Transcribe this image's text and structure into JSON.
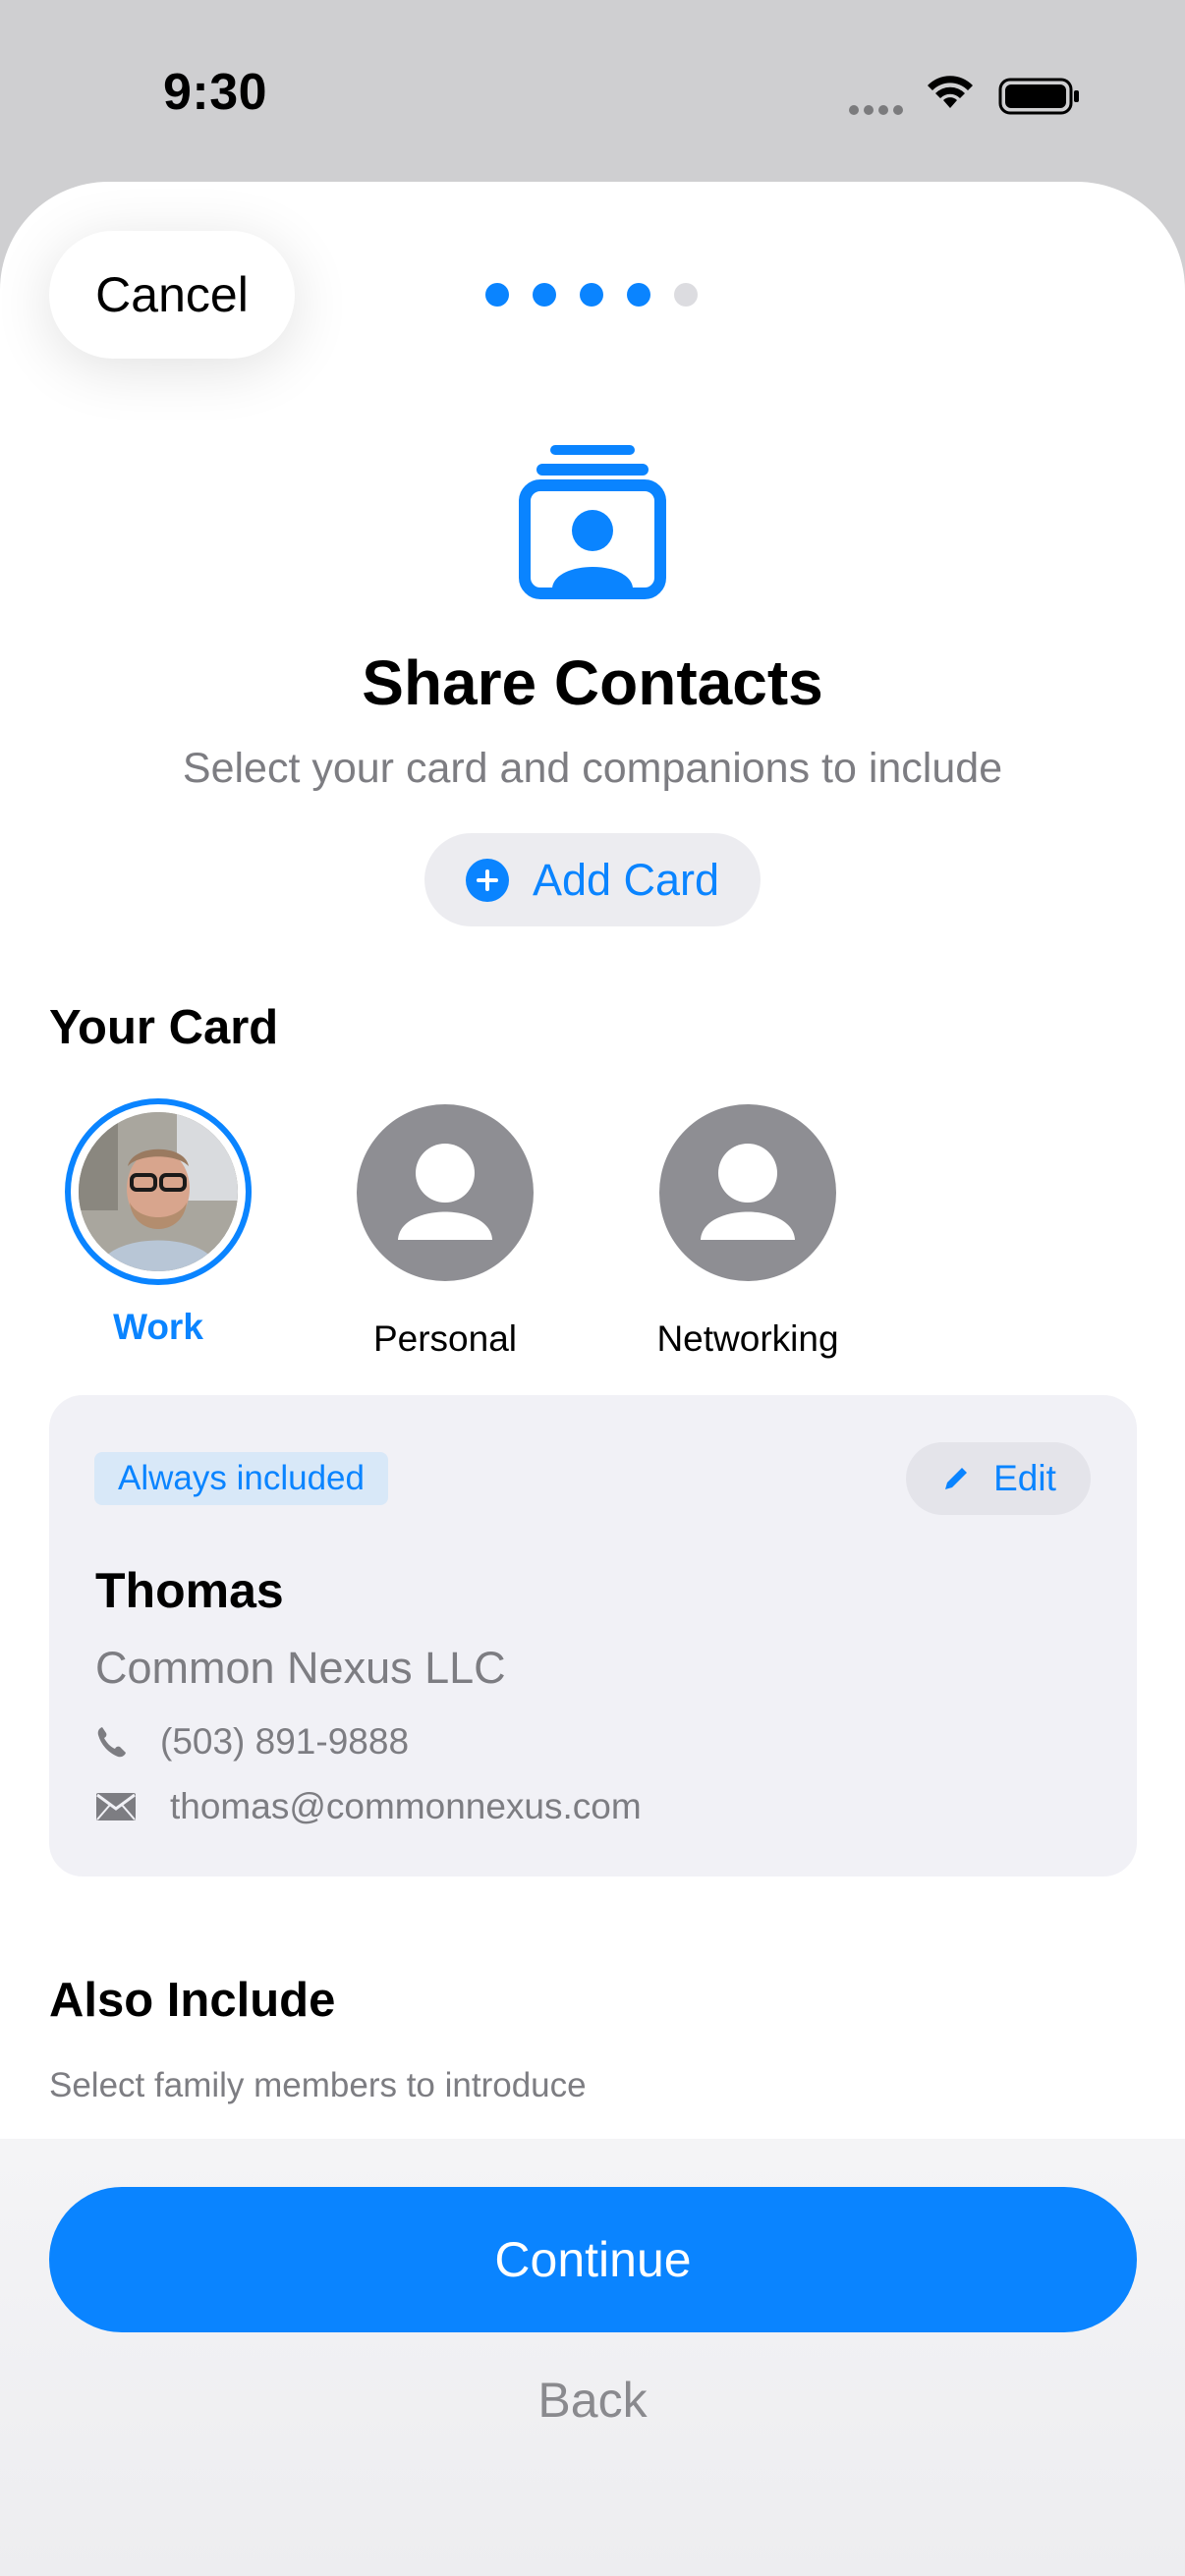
{
  "status_bar": {
    "time": "9:30",
    "icons": [
      "cellular-icon",
      "wifi-icon",
      "battery-icon"
    ]
  },
  "header": {
    "cancel_label": "Cancel",
    "pager": {
      "total": 5,
      "active": 4
    }
  },
  "hero": {
    "icon": "contact-card-stack-icon",
    "title": "Share Contacts",
    "subtitle": "Select your card and companions to include",
    "add_card_label": "Add Card"
  },
  "your_card": {
    "heading": "Your Card",
    "options": [
      {
        "label": "Work",
        "selected": true,
        "avatar": "photo"
      },
      {
        "label": "Personal",
        "selected": false,
        "avatar": "person-icon"
      },
      {
        "label": "Networking",
        "selected": false,
        "avatar": "person-icon"
      }
    ]
  },
  "card_details": {
    "badge": "Always included",
    "edit_label": "Edit",
    "name": "Thomas",
    "company": "Common Nexus LLC",
    "phone": "(503) 891-9888",
    "email": "thomas@commonnexus.com"
  },
  "also_include": {
    "heading": "Also Include",
    "subtitle": "Select family members to introduce"
  },
  "footer": {
    "continue_label": "Continue",
    "back_label": "Back"
  },
  "colors": {
    "accent": "#0a84ff",
    "secondary_text": "#7d7d82",
    "card_bg": "#f1f1f6"
  }
}
